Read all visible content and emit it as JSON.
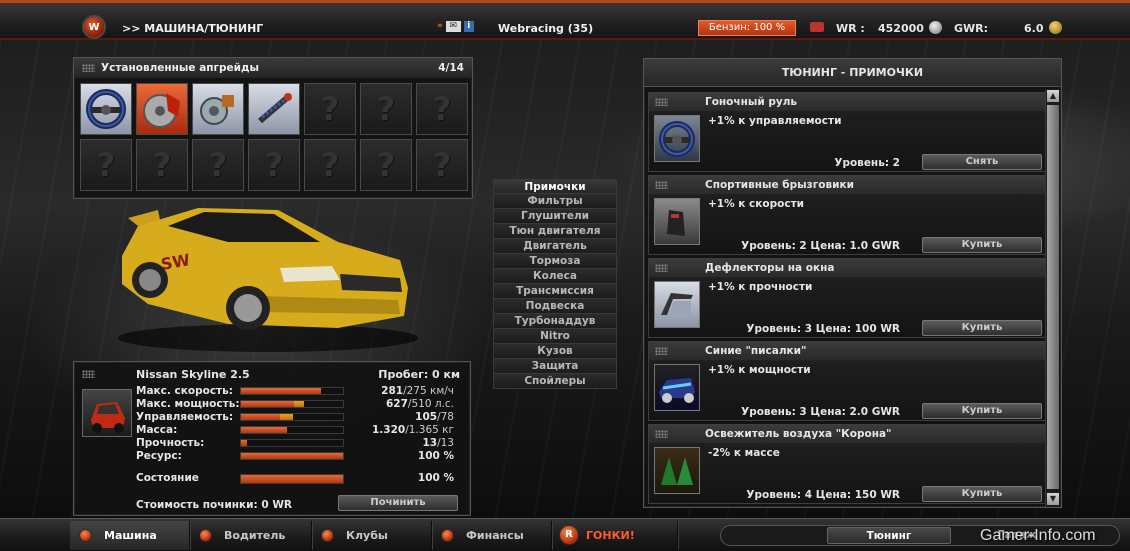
{
  "topbar": {
    "logo_letter": "W",
    "title": ">> МАШИНА/ТЮНИНГ",
    "icons": [
      "forward-arrows-icon",
      "mail-icon",
      "info-icon"
    ],
    "user": "Webracing (35)",
    "fuel": "Бензин: 100 %",
    "wr_label": "WR :",
    "wr_value": "452000",
    "gwr_label": "GWR:",
    "gwr_value": "6.0"
  },
  "upgrades": {
    "title": "Установленные апгрейды",
    "count": "4/14",
    "installed_icons": [
      "steering-wheel-icon",
      "brake-disc-icon",
      "turbo-icon",
      "suspension-icon"
    ],
    "empty_symbol": "?"
  },
  "categories": [
    {
      "label": "Примочки",
      "active": true
    },
    {
      "label": "Фильтры",
      "active": false
    },
    {
      "label": "Глушители",
      "active": false
    },
    {
      "label": "Тюн двигателя",
      "active": false
    },
    {
      "label": "Двигатель",
      "active": false
    },
    {
      "label": "Тормоза",
      "active": false
    },
    {
      "label": "Колеса",
      "active": false
    },
    {
      "label": "Трансмиссия",
      "active": false
    },
    {
      "label": "Подвеска",
      "active": false
    },
    {
      "label": "Турбонаддув",
      "active": false
    },
    {
      "label": "Nitro",
      "active": false
    },
    {
      "label": "Кузов",
      "active": false
    },
    {
      "label": "Защита",
      "active": false
    },
    {
      "label": "Спойлеры",
      "active": false
    }
  ],
  "car": {
    "name": "Nissan Skyline 2.5",
    "mileage": "Пробег: 0 км",
    "stats": [
      {
        "label": "Макс. скорость:",
        "value": "281",
        "max": "/275 км/ч",
        "fill": 0.78,
        "extra": 0
      },
      {
        "label": "Макс. мощность:",
        "value": "627",
        "max": "/510 л.с.",
        "fill": 0.52,
        "extra": 0.1
      },
      {
        "label": "Управляемость:",
        "value": "105",
        "max": "/78",
        "fill": 0.38,
        "extra": 0.13
      },
      {
        "label": "Масса:",
        "value": "1.320",
        "max": "/1.365 кг",
        "fill": 0.45,
        "extra": 0
      },
      {
        "label": "Прочность:",
        "value": "13",
        "max": "/13",
        "fill": 0.06,
        "extra": 0
      },
      {
        "label": "Ресурс:",
        "value": "100 %",
        "max": "",
        "fill": 1.0,
        "extra": 0
      },
      {
        "label": "Состояние",
        "value": "100 %",
        "max": "",
        "fill": 1.0,
        "extra": 0
      }
    ],
    "repair_cost": "Стоимость починки: 0 WR",
    "repair_button": "Починить"
  },
  "tuning": {
    "title": "ТЮНИНГ - ПРИМОЧКИ",
    "items": [
      {
        "name": "Гоночный руль",
        "effect": "+1% к управляемости",
        "level": "Уровень: 2",
        "action": "Снять",
        "icon": "steering-wheel-icon"
      },
      {
        "name": "Спортивные брызговики",
        "effect": "+1% к скорости",
        "level": "Уровень: 2 Цена: 1.0 GWR",
        "action": "Купить",
        "icon": "mudflap-icon"
      },
      {
        "name": "Дефлекторы на окна",
        "effect": "+1% к прочности",
        "level": "Уровень: 3 Цена: 100 WR",
        "action": "Купить",
        "icon": "window-deflector-icon"
      },
      {
        "name": "Синие \"писалки\"",
        "effect": "+1% к мощности",
        "level": "Уровень: 3 Цена: 2.0 GWR",
        "action": "Купить",
        "icon": "blue-lights-icon"
      },
      {
        "name": "Освежитель воздуха \"Корона\"",
        "effect": "-2% к массе",
        "level": "Уровень: 4 Цена: 150 WR",
        "action": "Купить",
        "icon": "air-freshener-icon"
      }
    ]
  },
  "nav": {
    "tabs": [
      {
        "label": "Машина",
        "active": true
      },
      {
        "label": "Водитель",
        "active": false
      },
      {
        "label": "Клубы",
        "active": false
      },
      {
        "label": "Финансы",
        "active": false
      },
      {
        "label": "ГОНКИ!",
        "active": false
      }
    ],
    "race_letter": "R",
    "subtabs": [
      {
        "label": "Тюнинг",
        "active": true
      },
      {
        "label": "Гараж",
        "active": false
      }
    ]
  },
  "watermark": "Gamer-Info.com",
  "colors": {
    "accent": "#e25a2a",
    "bar": "#c8461a",
    "bar_extra": "#f2a020"
  }
}
